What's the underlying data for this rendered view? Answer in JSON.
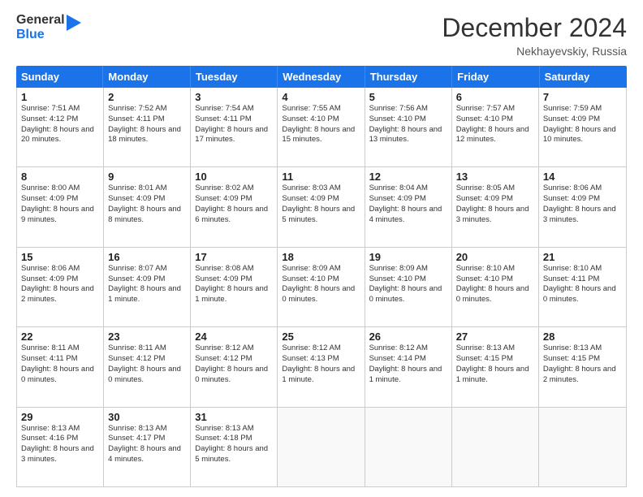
{
  "header": {
    "logo_line1": "General",
    "logo_line2": "Blue",
    "month_title": "December 2024",
    "subtitle": "Nekhayevskiy, Russia"
  },
  "days_of_week": [
    "Sunday",
    "Monday",
    "Tuesday",
    "Wednesday",
    "Thursday",
    "Friday",
    "Saturday"
  ],
  "weeks": [
    [
      {
        "day": "1",
        "sunrise": "Sunrise: 7:51 AM",
        "sunset": "Sunset: 4:12 PM",
        "daylight": "Daylight: 8 hours and 20 minutes.",
        "empty": false
      },
      {
        "day": "2",
        "sunrise": "Sunrise: 7:52 AM",
        "sunset": "Sunset: 4:11 PM",
        "daylight": "Daylight: 8 hours and 18 minutes.",
        "empty": false
      },
      {
        "day": "3",
        "sunrise": "Sunrise: 7:54 AM",
        "sunset": "Sunset: 4:11 PM",
        "daylight": "Daylight: 8 hours and 17 minutes.",
        "empty": false
      },
      {
        "day": "4",
        "sunrise": "Sunrise: 7:55 AM",
        "sunset": "Sunset: 4:10 PM",
        "daylight": "Daylight: 8 hours and 15 minutes.",
        "empty": false
      },
      {
        "day": "5",
        "sunrise": "Sunrise: 7:56 AM",
        "sunset": "Sunset: 4:10 PM",
        "daylight": "Daylight: 8 hours and 13 minutes.",
        "empty": false
      },
      {
        "day": "6",
        "sunrise": "Sunrise: 7:57 AM",
        "sunset": "Sunset: 4:10 PM",
        "daylight": "Daylight: 8 hours and 12 minutes.",
        "empty": false
      },
      {
        "day": "7",
        "sunrise": "Sunrise: 7:59 AM",
        "sunset": "Sunset: 4:09 PM",
        "daylight": "Daylight: 8 hours and 10 minutes.",
        "empty": false
      }
    ],
    [
      {
        "day": "8",
        "sunrise": "Sunrise: 8:00 AM",
        "sunset": "Sunset: 4:09 PM",
        "daylight": "Daylight: 8 hours and 9 minutes.",
        "empty": false
      },
      {
        "day": "9",
        "sunrise": "Sunrise: 8:01 AM",
        "sunset": "Sunset: 4:09 PM",
        "daylight": "Daylight: 8 hours and 8 minutes.",
        "empty": false
      },
      {
        "day": "10",
        "sunrise": "Sunrise: 8:02 AM",
        "sunset": "Sunset: 4:09 PM",
        "daylight": "Daylight: 8 hours and 6 minutes.",
        "empty": false
      },
      {
        "day": "11",
        "sunrise": "Sunrise: 8:03 AM",
        "sunset": "Sunset: 4:09 PM",
        "daylight": "Daylight: 8 hours and 5 minutes.",
        "empty": false
      },
      {
        "day": "12",
        "sunrise": "Sunrise: 8:04 AM",
        "sunset": "Sunset: 4:09 PM",
        "daylight": "Daylight: 8 hours and 4 minutes.",
        "empty": false
      },
      {
        "day": "13",
        "sunrise": "Sunrise: 8:05 AM",
        "sunset": "Sunset: 4:09 PM",
        "daylight": "Daylight: 8 hours and 3 minutes.",
        "empty": false
      },
      {
        "day": "14",
        "sunrise": "Sunrise: 8:06 AM",
        "sunset": "Sunset: 4:09 PM",
        "daylight": "Daylight: 8 hours and 3 minutes.",
        "empty": false
      }
    ],
    [
      {
        "day": "15",
        "sunrise": "Sunrise: 8:06 AM",
        "sunset": "Sunset: 4:09 PM",
        "daylight": "Daylight: 8 hours and 2 minutes.",
        "empty": false
      },
      {
        "day": "16",
        "sunrise": "Sunrise: 8:07 AM",
        "sunset": "Sunset: 4:09 PM",
        "daylight": "Daylight: 8 hours and 1 minute.",
        "empty": false
      },
      {
        "day": "17",
        "sunrise": "Sunrise: 8:08 AM",
        "sunset": "Sunset: 4:09 PM",
        "daylight": "Daylight: 8 hours and 1 minute.",
        "empty": false
      },
      {
        "day": "18",
        "sunrise": "Sunrise: 8:09 AM",
        "sunset": "Sunset: 4:10 PM",
        "daylight": "Daylight: 8 hours and 0 minutes.",
        "empty": false
      },
      {
        "day": "19",
        "sunrise": "Sunrise: 8:09 AM",
        "sunset": "Sunset: 4:10 PM",
        "daylight": "Daylight: 8 hours and 0 minutes.",
        "empty": false
      },
      {
        "day": "20",
        "sunrise": "Sunrise: 8:10 AM",
        "sunset": "Sunset: 4:10 PM",
        "daylight": "Daylight: 8 hours and 0 minutes.",
        "empty": false
      },
      {
        "day": "21",
        "sunrise": "Sunrise: 8:10 AM",
        "sunset": "Sunset: 4:11 PM",
        "daylight": "Daylight: 8 hours and 0 minutes.",
        "empty": false
      }
    ],
    [
      {
        "day": "22",
        "sunrise": "Sunrise: 8:11 AM",
        "sunset": "Sunset: 4:11 PM",
        "daylight": "Daylight: 8 hours and 0 minutes.",
        "empty": false
      },
      {
        "day": "23",
        "sunrise": "Sunrise: 8:11 AM",
        "sunset": "Sunset: 4:12 PM",
        "daylight": "Daylight: 8 hours and 0 minutes.",
        "empty": false
      },
      {
        "day": "24",
        "sunrise": "Sunrise: 8:12 AM",
        "sunset": "Sunset: 4:12 PM",
        "daylight": "Daylight: 8 hours and 0 minutes.",
        "empty": false
      },
      {
        "day": "25",
        "sunrise": "Sunrise: 8:12 AM",
        "sunset": "Sunset: 4:13 PM",
        "daylight": "Daylight: 8 hours and 1 minute.",
        "empty": false
      },
      {
        "day": "26",
        "sunrise": "Sunrise: 8:12 AM",
        "sunset": "Sunset: 4:14 PM",
        "daylight": "Daylight: 8 hours and 1 minute.",
        "empty": false
      },
      {
        "day": "27",
        "sunrise": "Sunrise: 8:13 AM",
        "sunset": "Sunset: 4:15 PM",
        "daylight": "Daylight: 8 hours and 1 minute.",
        "empty": false
      },
      {
        "day": "28",
        "sunrise": "Sunrise: 8:13 AM",
        "sunset": "Sunset: 4:15 PM",
        "daylight": "Daylight: 8 hours and 2 minutes.",
        "empty": false
      }
    ],
    [
      {
        "day": "29",
        "sunrise": "Sunrise: 8:13 AM",
        "sunset": "Sunset: 4:16 PM",
        "daylight": "Daylight: 8 hours and 3 minutes.",
        "empty": false
      },
      {
        "day": "30",
        "sunrise": "Sunrise: 8:13 AM",
        "sunset": "Sunset: 4:17 PM",
        "daylight": "Daylight: 8 hours and 4 minutes.",
        "empty": false
      },
      {
        "day": "31",
        "sunrise": "Sunrise: 8:13 AM",
        "sunset": "Sunset: 4:18 PM",
        "daylight": "Daylight: 8 hours and 5 minutes.",
        "empty": false
      },
      {
        "day": "",
        "sunrise": "",
        "sunset": "",
        "daylight": "",
        "empty": true
      },
      {
        "day": "",
        "sunrise": "",
        "sunset": "",
        "daylight": "",
        "empty": true
      },
      {
        "day": "",
        "sunrise": "",
        "sunset": "",
        "daylight": "",
        "empty": true
      },
      {
        "day": "",
        "sunrise": "",
        "sunset": "",
        "daylight": "",
        "empty": true
      }
    ]
  ]
}
